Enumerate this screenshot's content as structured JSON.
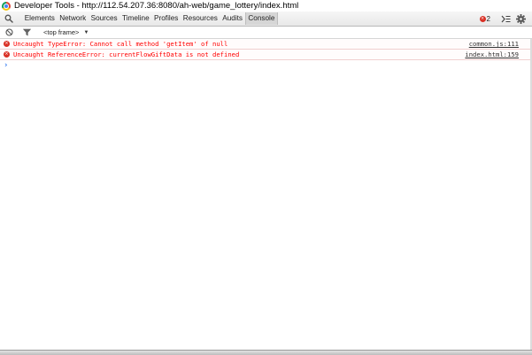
{
  "window": {
    "title": "Developer Tools - http://112.54.207.36:8080/ah-web/game_lottery/index.html"
  },
  "toolbar": {
    "search_icon": "search-icon",
    "tabs": [
      {
        "label": "Elements",
        "selected": false
      },
      {
        "label": "Network",
        "selected": false
      },
      {
        "label": "Sources",
        "selected": false
      },
      {
        "label": "Timeline",
        "selected": false
      },
      {
        "label": "Profiles",
        "selected": false
      },
      {
        "label": "Resources",
        "selected": false
      },
      {
        "label": "Audits",
        "selected": false
      },
      {
        "label": "Console",
        "selected": true
      }
    ],
    "error_count": "2",
    "drawer_icon": "show-drawer-icon",
    "settings_icon": "gear-icon"
  },
  "filter_bar": {
    "clear_icon": "clear-console-icon",
    "filter_icon": "filter-icon",
    "frame_selector": "<top frame>"
  },
  "console": {
    "messages": [
      {
        "level": "error",
        "text": "Uncaught TypeError: Cannot call method 'getItem' of null",
        "source": "common.js:111"
      },
      {
        "level": "error",
        "text": "Uncaught ReferenceError: currentFlowGiftData is not defined",
        "source": "index.html:159"
      }
    ],
    "prompt_icon": "prompt-chevron-icon"
  },
  "colors": {
    "error_text": "#ff0000",
    "error_icon": "#d93025",
    "prompt": "#367cf1",
    "toolbar_bg": "#ececec",
    "selected_tab": "#d6d6d6"
  }
}
